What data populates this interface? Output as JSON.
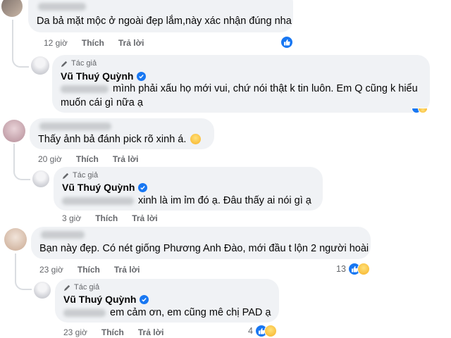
{
  "actions": {
    "like": "Thích",
    "reply": "Trả lời"
  },
  "author_badge": "Tác giả",
  "author_name": "Vũ Thuý Quỳnh",
  "colors": {
    "accent": "#1877f2",
    "bubble": "#f0f2f5",
    "meta": "#65676b"
  },
  "comments": [
    {
      "text": "Da bả mặt mộc ở ngoài đẹp lắm,này xác nhận đúng nha",
      "time": "12 giờ",
      "reactions": {
        "icons": [
          "like-icon"
        ],
        "count": ""
      }
    },
    {
      "text": "mình phải xấu họ mới vui, chứ nói thật k tin luôn. Em Q cũng k hiểu",
      "text2": "muốn cái gì nữa ạ"
    },
    {
      "text": "Thấy ảnh bả đánh pick rõ xinh á.",
      "time": "20 giờ"
    },
    {
      "text": "xinh là im ỉm đó ạ. Đâu thấy ai nói gì ạ",
      "time": "3 giờ"
    },
    {
      "text": "Bạn này đẹp. Có nét giống Phương Anh Đào, mới đầu t lộn 2 người hoài",
      "time": "23 giờ",
      "reactions": {
        "icons": [
          "like-icon",
          "haha-icon"
        ],
        "count": "13"
      }
    },
    {
      "text": "em cảm ơn, em cũng mê chị PAD ạ",
      "time": "23 giờ",
      "reactions": {
        "icons": [
          "like-icon",
          "sad-icon"
        ],
        "count": "4"
      }
    }
  ]
}
